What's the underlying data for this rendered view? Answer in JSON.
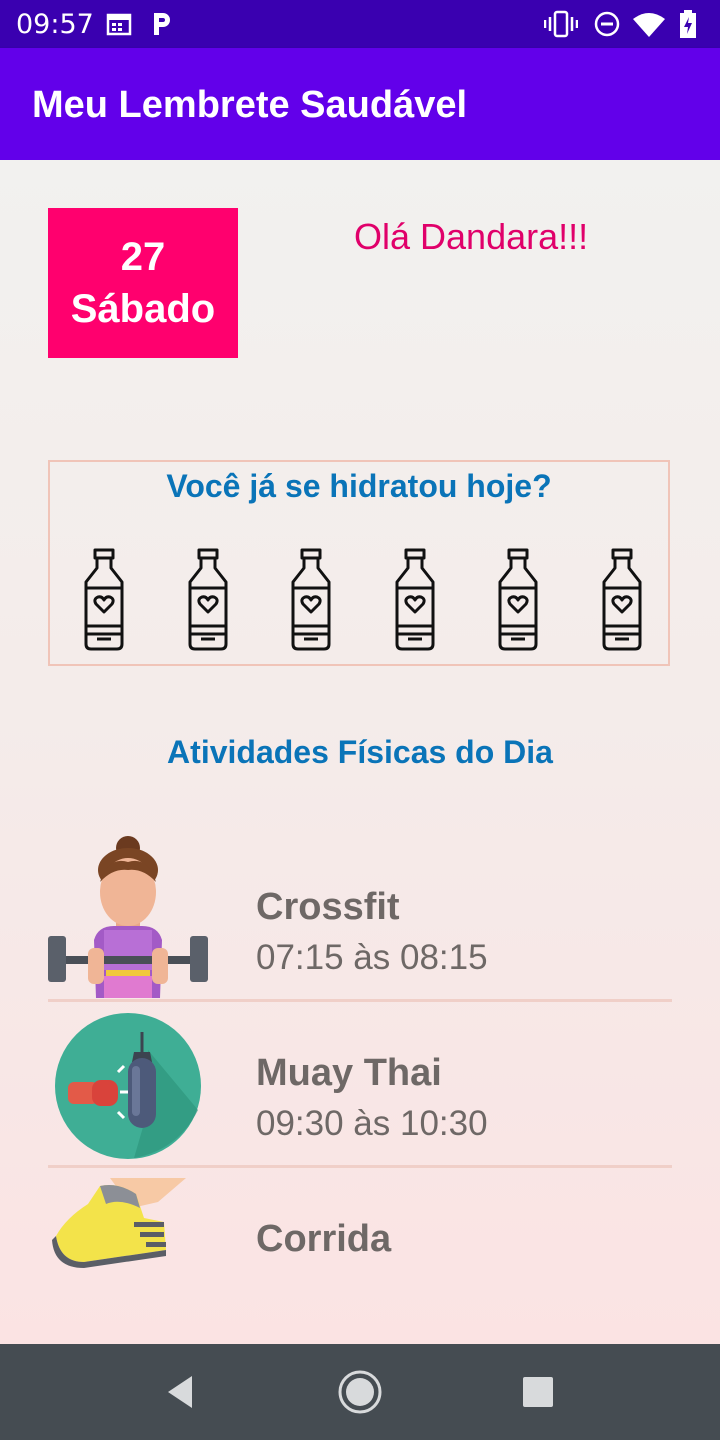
{
  "status_bar": {
    "time": "09:57",
    "icons": [
      "calendar-icon",
      "parking-p-icon",
      "vibrate-icon",
      "do-not-disturb-icon",
      "wifi-icon",
      "battery-charging-icon"
    ]
  },
  "app_bar": {
    "title": "Meu Lembrete Saudável"
  },
  "date_card": {
    "day": "27",
    "weekday": "Sábado"
  },
  "greeting": "Olá Dandara!!!",
  "hydration": {
    "question": "Você já se hidratou hoje?",
    "bottle_count": 6,
    "bottle_icon": "water-bottle-heart-icon"
  },
  "activities_title": "Atividades Físicas do Dia",
  "activities": [
    {
      "name": "Crossfit",
      "time": "07:15 às 08:15",
      "icon": "weightlifter-woman-icon"
    },
    {
      "name": "Muay Thai",
      "time": "09:30 às 10:30",
      "icon": "boxing-bag-icon"
    },
    {
      "name": "Corrida",
      "time": "",
      "icon": "running-shoe-icon"
    }
  ],
  "colors": {
    "status_bar": "#3a00b0",
    "app_bar": "#6200ea",
    "date_card": "#ff006e",
    "greeting": "#e0006a",
    "section_title": "#0a74b8",
    "activity_text": "#6e6866",
    "nav_bar": "#454c52"
  },
  "nav_bar": {
    "icons": [
      "back-icon",
      "home-icon",
      "recents-icon"
    ]
  }
}
